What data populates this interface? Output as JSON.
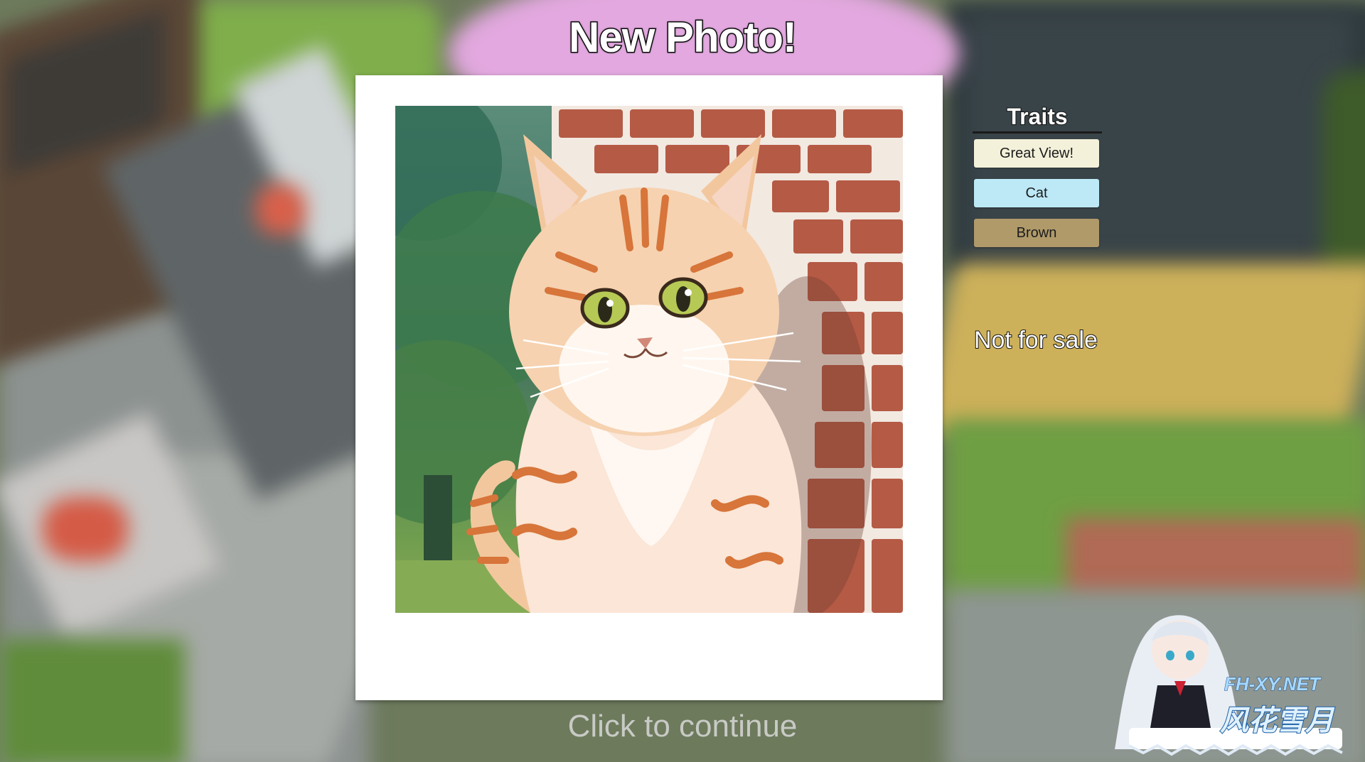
{
  "header": {
    "title": "New Photo!"
  },
  "photo": {
    "subject": "cat"
  },
  "traits": {
    "heading": "Traits",
    "items": [
      {
        "label": "Great View!",
        "color": "#f4f1da"
      },
      {
        "label": "Cat",
        "color": "#bde9f7"
      },
      {
        "label": "Brown",
        "color": "#b09a6a"
      }
    ]
  },
  "sale_status": "Not for sale",
  "prompt": "Click to continue",
  "watermark": {
    "site": "FH-XY.NET",
    "brand": "风花雪月"
  }
}
